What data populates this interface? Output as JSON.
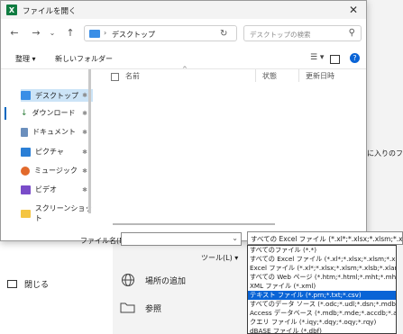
{
  "dialog": {
    "title": "ファイルを開く",
    "address_path": "デスクトップ",
    "search_placeholder": "デスクトップの検索",
    "commands": {
      "organize": "整理 ▾",
      "new_folder": "新しいフォルダー"
    },
    "columns": {
      "name": "名前",
      "status": "状態",
      "modified": "更新日時"
    },
    "nav_items": [
      {
        "label": "デスクトップ",
        "icon": "desktop-icon",
        "selected": true
      },
      {
        "label": "ダウンロード",
        "icon": "download-icon"
      },
      {
        "label": "ドキュメント",
        "icon": "document-icon"
      },
      {
        "label": "ピクチャ",
        "icon": "picture-icon"
      },
      {
        "label": "ミュージック",
        "icon": "music-icon"
      },
      {
        "label": "ビデオ",
        "icon": "video-icon"
      },
      {
        "label": "スクリーンショット",
        "icon": "folder-icon"
      }
    ],
    "filename_label": "ファイル名(N):",
    "filename_value": "",
    "tools_label": "ツール(L)",
    "tools_arrow": "▾",
    "filetype_selected": "すべての Excel ファイル (*.xl*;*.xlsx;*.xlsm;*.xlsb;*.xlam"
  },
  "filetype_options": [
    "すべてのファイル (*.*)",
    "すべての Excel ファイル (*.xl*;*.xlsx;*.xlsm;*.xlsb;*.xlam;*.xltx;",
    "Excel ファイル (*.xl*;*.xlsx;*.xlsm;*.xlsb;*.xlam;*.xltx;*.xltm;",
    "すべての Web ページ (*.htm;*.html;*.mht;*.mhtml)",
    "XML ファイル (*.xml)",
    "テキスト ファイル (*.prn;*.txt;*.csv)",
    "すべてのデータ ソース (*.odc;*.udl;*.dsn;*.mdb;*.mde;*.accdb;",
    "Access データベース (*.mdb;*.mde;*.accdb;*.accde)",
    "クエリ ファイル (*.iqy;*.dqy;*.oqy;*.rqy)",
    "dBASE ファイル (*.dbf)"
  ],
  "selected_option_index": 5,
  "background": {
    "close_label": "閉じる",
    "add_place_label": "場所の追加",
    "browse_label": "参照",
    "right_text": "に入りのファ"
  }
}
